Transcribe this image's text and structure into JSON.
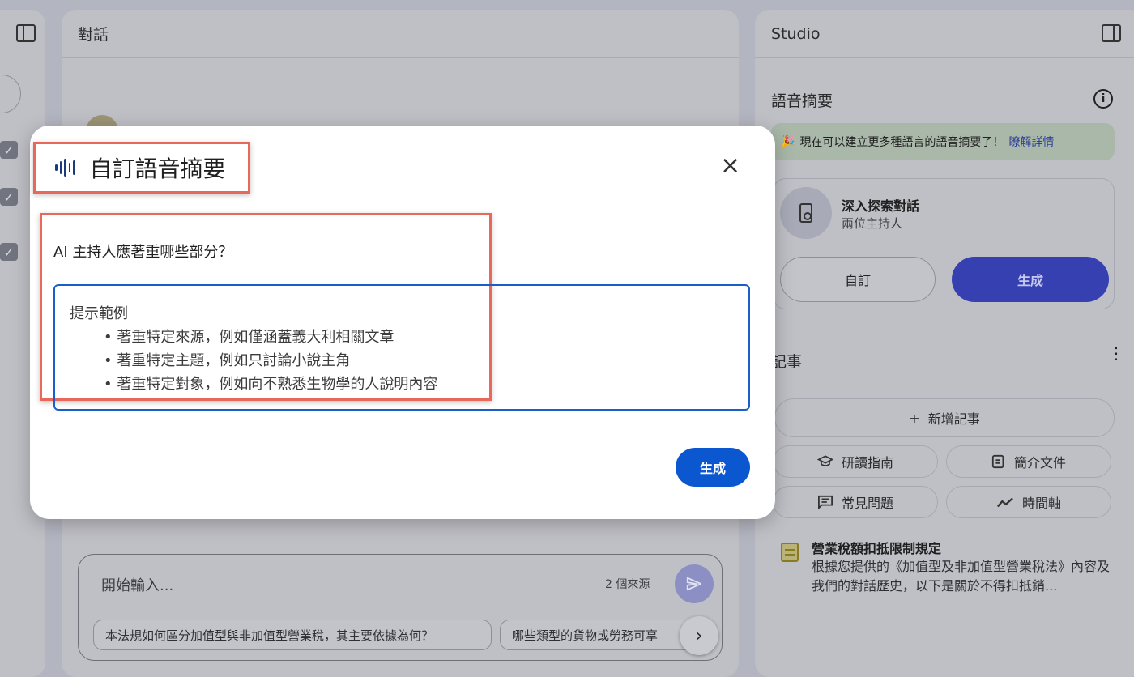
{
  "left_panel": {
    "checkbox_mark": "✓"
  },
  "chat": {
    "header_title": "對話",
    "input_placeholder": "開始輸入...",
    "source_count": "2 個來源",
    "suggestions": [
      "本法規如何區分加值型與非加值型營業稅，其主要依據為何？",
      "哪些類型的貨物或勞務可享"
    ],
    "send_icon": "send-icon",
    "next_icon": "chevron-right-icon"
  },
  "studio": {
    "header_title": "Studio",
    "audio_summary_title": "語音摘要",
    "banner_text": "現在可以建立更多種語言的語音摘要了！",
    "banner_link": "瞭解詳情",
    "banner_emoji": "🎉",
    "audio_card": {
      "title": "深入探索對話",
      "subtitle": "兩位主持人",
      "custom_label": "自訂",
      "generate_label": "生成"
    },
    "notes_title": "記事",
    "add_note_label": "新增記事",
    "chips": [
      {
        "label": "研讀指南",
        "icon": "graduation-cap-icon"
      },
      {
        "label": "簡介文件",
        "icon": "document-icon"
      },
      {
        "label": "常見問題",
        "icon": "faq-icon"
      },
      {
        "label": "時間軸",
        "icon": "timeline-icon"
      }
    ],
    "note_item": {
      "title": "營業稅額扣抵限制規定",
      "text": "根據您提供的《加值型及非加值型營業稅法》內容及我們的對話歷史，以下是關於不得扣抵銷..."
    }
  },
  "modal": {
    "title": "自訂語音摘要",
    "question": "AI 主持人應著重哪些部分？",
    "placeholder_head": "提示範例",
    "placeholder_items": [
      "• 著重特定來源，例如僅涵蓋義大利相關文章",
      "• 著重特定主題，例如只討論小說主角",
      "• 著重特定對象，例如向不熟悉生物學的人說明內容"
    ],
    "generate_label": "生成",
    "close_glyph": "×"
  },
  "colors": {
    "primary_blue": "#0b57d0",
    "annotation_red": "#e8685a"
  }
}
